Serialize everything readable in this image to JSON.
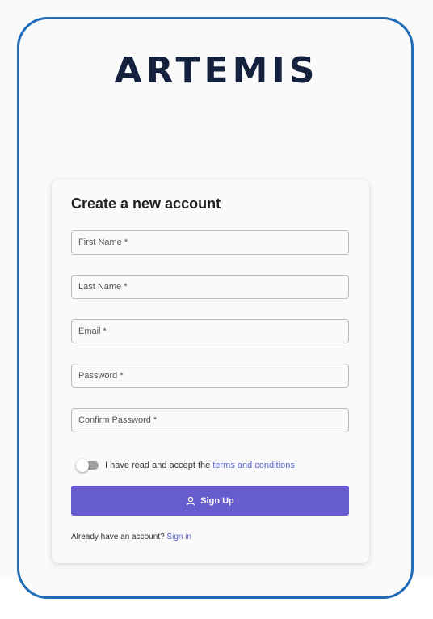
{
  "brand": {
    "logo_text": "ARTEMIS"
  },
  "form": {
    "title": "Create a new account",
    "fields": [
      {
        "placeholder": "First Name *",
        "value": ""
      },
      {
        "placeholder": "Last Name *",
        "value": ""
      },
      {
        "placeholder": "Email *",
        "value": ""
      },
      {
        "placeholder": "Password *",
        "value": ""
      },
      {
        "placeholder": "Confirm Password *",
        "value": ""
      }
    ],
    "terms": {
      "prefix": "I have read and accept the",
      "link": "terms and conditions",
      "accepted": false
    },
    "submit_label": "Sign Up",
    "signin_prompt": "Already have an account?",
    "signin_link": "Sign in"
  },
  "colors": {
    "frame_border": "#1f6bb8",
    "primary_button": "#675ccd",
    "link": "#5b63d3",
    "logo": "#14213d"
  },
  "icons": {
    "submit_icon": "user-icon"
  }
}
